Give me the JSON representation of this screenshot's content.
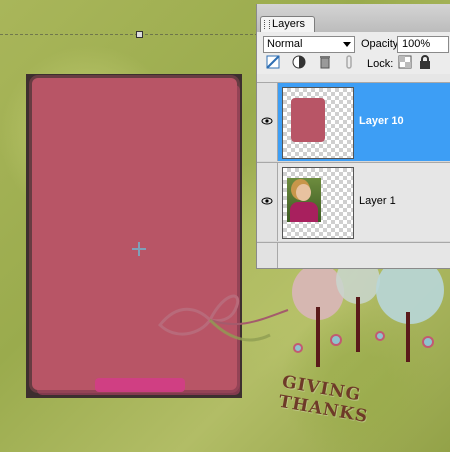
{
  "canvas": {
    "decor_text": "GIVING THANKS"
  },
  "layers_panel": {
    "tab_label": "Layers",
    "blend_mode": "Normal",
    "opacity_label": "Opacity:",
    "opacity_value": "100%",
    "lock_label": "Lock:",
    "tools": [
      "new-fill-layer-icon",
      "adjustment-icon",
      "trash-icon",
      "link-icon"
    ],
    "layers": [
      {
        "name": "Layer 10",
        "selected": true,
        "visible": true,
        "thumb": "pink-frame"
      },
      {
        "name": "Layer 1",
        "selected": false,
        "visible": true,
        "thumb": "girl-photo"
      }
    ]
  },
  "colors": {
    "selection": "#3d9ef5",
    "photo_frame_pink": "#b85566",
    "background_green": "#a9b65a"
  }
}
